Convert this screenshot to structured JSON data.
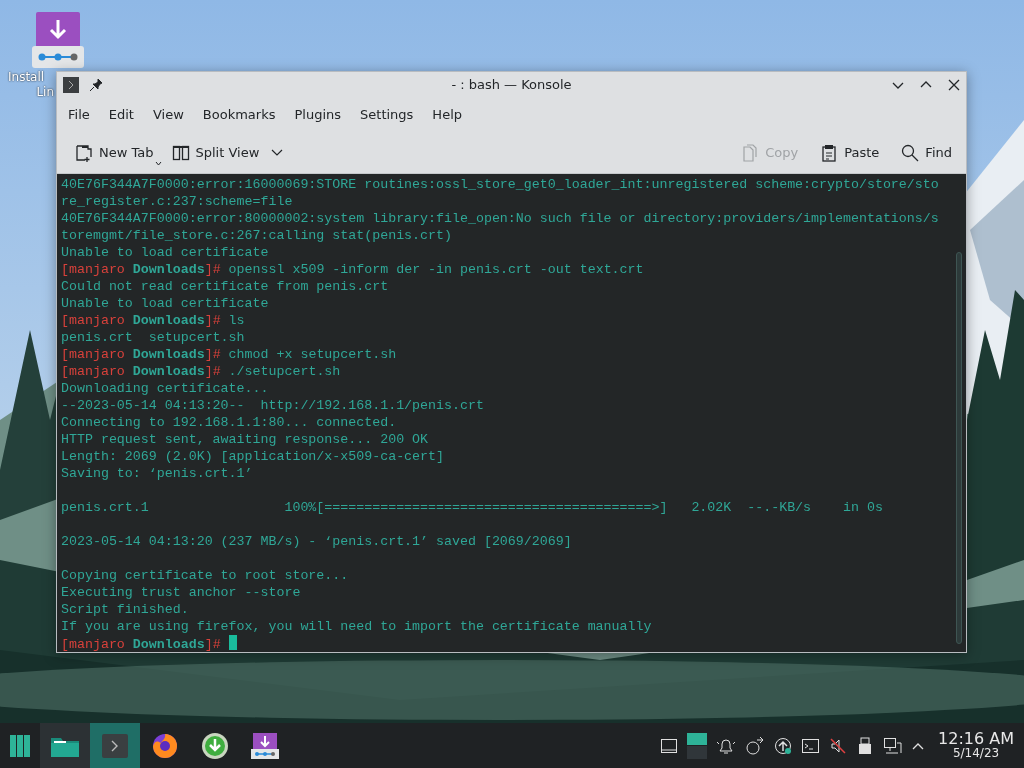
{
  "desktop": {
    "icons": [
      {
        "label_lines": [
          "Install",
          "Lin"
        ]
      }
    ]
  },
  "window": {
    "title": "- : bash — Konsole",
    "menu": [
      "File",
      "Edit",
      "View",
      "Bookmarks",
      "Plugins",
      "Settings",
      "Help"
    ],
    "toolbar_left": [
      {
        "kind": "new-tab",
        "label": "New Tab",
        "disabled": false
      },
      {
        "kind": "split-view",
        "label": "Split View",
        "disabled": false
      }
    ],
    "toolbar_right": [
      {
        "kind": "copy",
        "label": "Copy",
        "disabled": true
      },
      {
        "kind": "paste",
        "label": "Paste",
        "disabled": false
      },
      {
        "kind": "find",
        "label": "Find",
        "disabled": false
      }
    ],
    "terminal": {
      "lines": [
        {
          "kind": "output",
          "text": "40E76F344A7F0000:error:16000069:STORE routines:ossl_store_get0_loader_int:unregistered scheme:crypto/store/sto"
        },
        {
          "kind": "output",
          "text": "re_register.c:237:scheme=file"
        },
        {
          "kind": "output",
          "text": "40E76F344A7F0000:error:80000002:system library:file_open:No such file or directory:providers/implementations/s"
        },
        {
          "kind": "output",
          "text": "toremgmt/file_store.c:267:calling stat(penis.crt)"
        },
        {
          "kind": "output",
          "text": "Unable to load certificate"
        },
        {
          "kind": "prompt",
          "user": "[manjaro",
          "dir": "Downloads",
          "end": "]#",
          "command": " openssl x509 -inform der -in penis.crt -out text.crt",
          "cursor": false
        },
        {
          "kind": "output",
          "text": "Could not read certificate from penis.crt"
        },
        {
          "kind": "output",
          "text": "Unable to load certificate"
        },
        {
          "kind": "prompt",
          "user": "[manjaro",
          "dir": "Downloads",
          "end": "]#",
          "command": " ls",
          "cursor": false
        },
        {
          "kind": "output",
          "text": "penis.crt  setupcert.sh"
        },
        {
          "kind": "prompt",
          "user": "[manjaro",
          "dir": "Downloads",
          "end": "]#",
          "command": " chmod +x setupcert.sh",
          "cursor": false
        },
        {
          "kind": "prompt",
          "user": "[manjaro",
          "dir": "Downloads",
          "end": "]#",
          "command": " ./setupcert.sh",
          "cursor": false
        },
        {
          "kind": "output",
          "text": "Downloading certificate..."
        },
        {
          "kind": "output",
          "text": "--2023-05-14 04:13:20--  http://192.168.1.1/penis.crt"
        },
        {
          "kind": "output",
          "text": "Connecting to 192.168.1.1:80... connected."
        },
        {
          "kind": "output",
          "text": "HTTP request sent, awaiting response... 200 OK"
        },
        {
          "kind": "output",
          "text": "Length: 2069 (2.0K) [application/x-x509-ca-cert]"
        },
        {
          "kind": "output",
          "text": "Saving to: ‘penis.crt.1’"
        },
        {
          "kind": "blank"
        },
        {
          "kind": "output",
          "text": "penis.crt.1                 100%[=========================================>]   2.02K  --.-KB/s    in 0s"
        },
        {
          "kind": "blank"
        },
        {
          "kind": "output",
          "text": "2023-05-14 04:13:20 (237 MB/s) - ‘penis.crt.1’ saved [2069/2069]"
        },
        {
          "kind": "blank"
        },
        {
          "kind": "output",
          "text": "Copying certificate to root store..."
        },
        {
          "kind": "output",
          "text": "Executing trust anchor --store"
        },
        {
          "kind": "output",
          "text": "Script finished."
        },
        {
          "kind": "output",
          "text": "If you are using firefox, you will need to import the certificate manually"
        },
        {
          "kind": "prompt",
          "user": "[manjaro",
          "dir": "Downloads",
          "end": "]#",
          "cursor": true
        }
      ]
    }
  },
  "taskbar": {
    "tasks": [
      {
        "kind": "start",
        "selected": false
      },
      {
        "kind": "files",
        "selected": false
      },
      {
        "kind": "terminal",
        "selected": true
      },
      {
        "kind": "browser",
        "selected": false
      },
      {
        "kind": "download",
        "selected": false
      },
      {
        "kind": "installer",
        "selected": false
      }
    ],
    "clock": {
      "time": "12:16 AM",
      "date": "5/14/23"
    }
  }
}
